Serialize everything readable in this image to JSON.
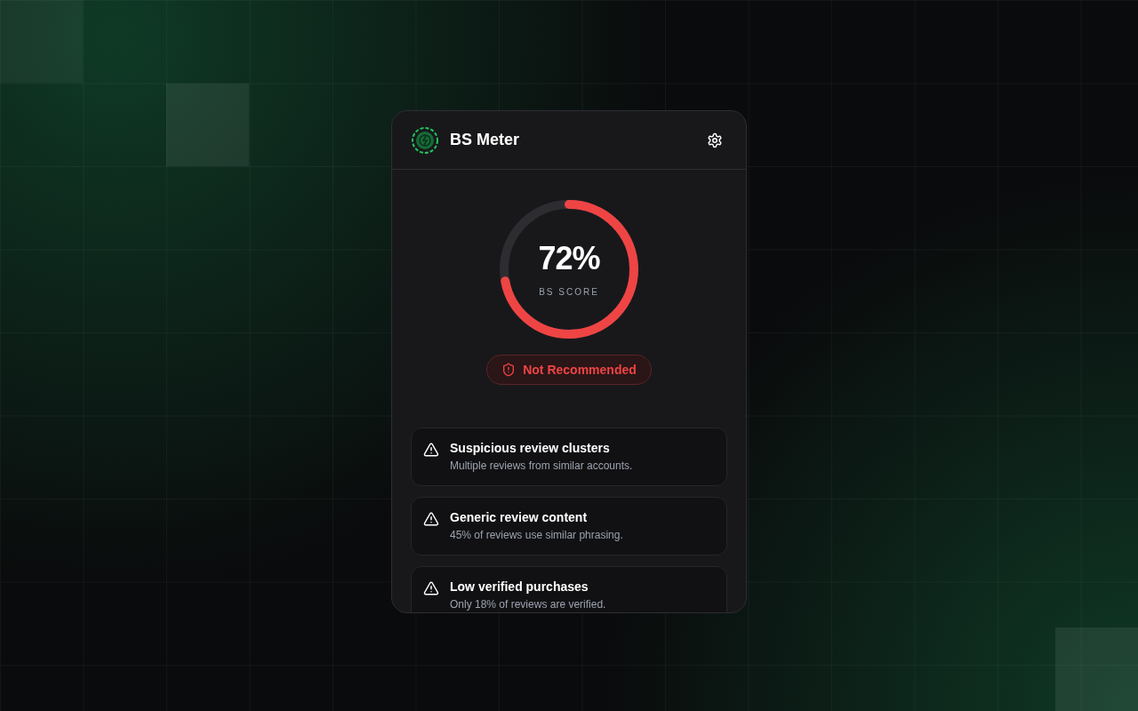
{
  "app": {
    "title": "BS Meter"
  },
  "score": {
    "value": "72%",
    "label": "BS SCORE",
    "level": 0.72
  },
  "verdict": {
    "label": "Not Recommended",
    "kind": "negative"
  },
  "findings": [
    {
      "kind": "warning",
      "title": "Suspicious review clusters",
      "description": "Multiple reviews from similar accounts."
    },
    {
      "kind": "warning",
      "title": "Generic review content",
      "description": "45% of reviews use similar phrasing."
    },
    {
      "kind": "warning",
      "title": "Low verified purchases",
      "description": "Only 18% of reviews are verified."
    }
  ]
}
